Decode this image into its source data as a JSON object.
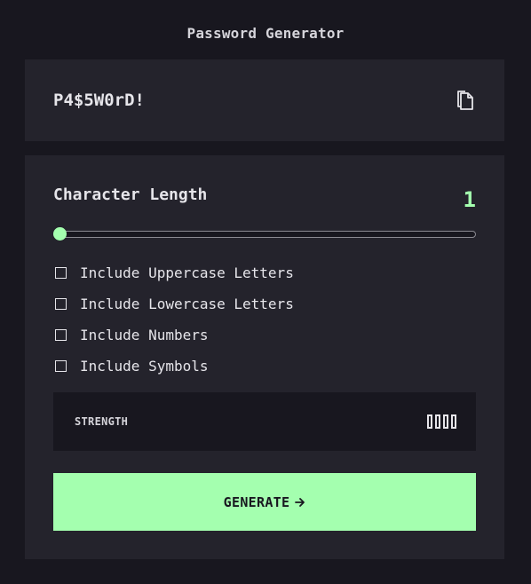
{
  "app": {
    "title": "Password Generator"
  },
  "output": {
    "password": "P4$5W0rD!",
    "copy_icon": "copy-icon"
  },
  "length": {
    "label": "Character Length",
    "value": "1",
    "slider_fraction": 0
  },
  "options": [
    {
      "label": "Include Uppercase Letters",
      "checked": false
    },
    {
      "label": "Include Lowercase Letters",
      "checked": false
    },
    {
      "label": "Include Numbers",
      "checked": false
    },
    {
      "label": "Include Symbols",
      "checked": false
    }
  ],
  "strength": {
    "label": "STRENGTH",
    "filled_bars": 0,
    "total_bars": 4
  },
  "generate": {
    "label": "GENERATE",
    "icon": "arrow-right-icon"
  },
  "colors": {
    "background": "#18171f",
    "panel": "#24232c",
    "accent": "#a4ffaf",
    "text": "#e6e5ea"
  }
}
